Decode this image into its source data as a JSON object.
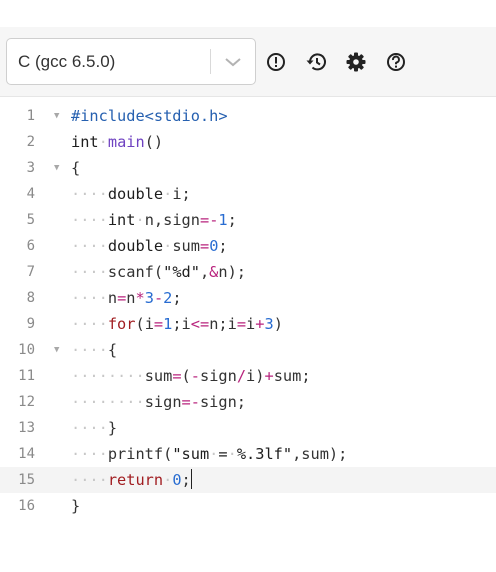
{
  "toolbar": {
    "language": "C (gcc 6.5.0)",
    "icons": [
      "chevron-down-icon",
      "info-icon",
      "history-icon",
      "gear-icon",
      "help-icon"
    ]
  },
  "editor": {
    "line_numbers": [
      "1",
      "2",
      "3",
      "4",
      "5",
      "6",
      "7",
      "8",
      "9",
      "10",
      "11",
      "12",
      "13",
      "14",
      "15",
      "16"
    ],
    "lines": [
      "#include<stdio.h>",
      "int main()",
      "{",
      "    double i;",
      "    int n,sign=-1;",
      "    double sum=0;",
      "    scanf(\"%d\",&n);",
      "    n=n*3-2;",
      "    for(i=1;i<=n;i=i+3)",
      "    {",
      "        sum=(-sign/i)+sum;",
      "        sign=-sign;",
      "    }",
      "    printf(\"sum = %.3lf\",sum);",
      "    return 0;",
      "}"
    ],
    "active_line": "15"
  }
}
